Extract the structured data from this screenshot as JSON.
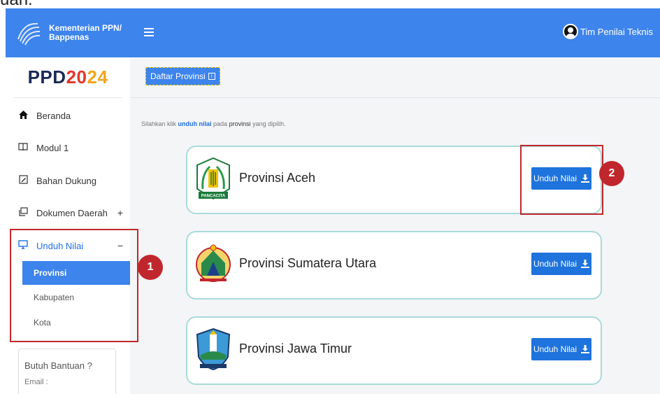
{
  "top_fragment": "uah.",
  "brand": {
    "line1": "Kementerian PPN/",
    "line2": "Bappenas"
  },
  "header": {
    "user_name": "Tim Penilai Teknis"
  },
  "sidebar": {
    "logo_ppd": "PPD",
    "logo_20": "20",
    "logo_24": "24",
    "items": [
      {
        "label": "Beranda",
        "icon": "home-icon"
      },
      {
        "label": "Modul 1",
        "icon": "book-icon"
      },
      {
        "label": "Bahan Dukung",
        "icon": "edit-icon"
      },
      {
        "label": "Dokumen Daerah",
        "icon": "copy-icon",
        "toggle": "+"
      },
      {
        "label": "Unduh Nilai",
        "icon": "monitor-icon",
        "toggle": "−"
      }
    ],
    "subitems": [
      {
        "label": "Provinsi",
        "active": true
      },
      {
        "label": "Kabupaten"
      },
      {
        "label": "Kota"
      }
    ],
    "help": {
      "title": "Butuh Bantuan ?",
      "email_label": "Email :"
    }
  },
  "breadcrumb": {
    "label": "Daftar Provinsi"
  },
  "instruction": {
    "part1": "Silahkan klik ",
    "link": "unduh nilai",
    "part2": " pada ",
    "provinsi": "provinsi",
    "part3": " yang dipilih."
  },
  "provinces": [
    {
      "name": "Provinsi Aceh",
      "button": "Unduh Nilai",
      "logo_text": "PANCACITA"
    },
    {
      "name": "Provinsi Sumatera Utara",
      "button": "Unduh Nilai"
    },
    {
      "name": "Provinsi Jawa Timur",
      "button": "Unduh Nilai"
    }
  ],
  "annotations": {
    "badge1": "1",
    "badge2": "2"
  },
  "colors": {
    "primary": "#3d84ec",
    "button": "#1e73dd",
    "annotation": "#c0272d",
    "card_border": "#a8dbd9"
  }
}
